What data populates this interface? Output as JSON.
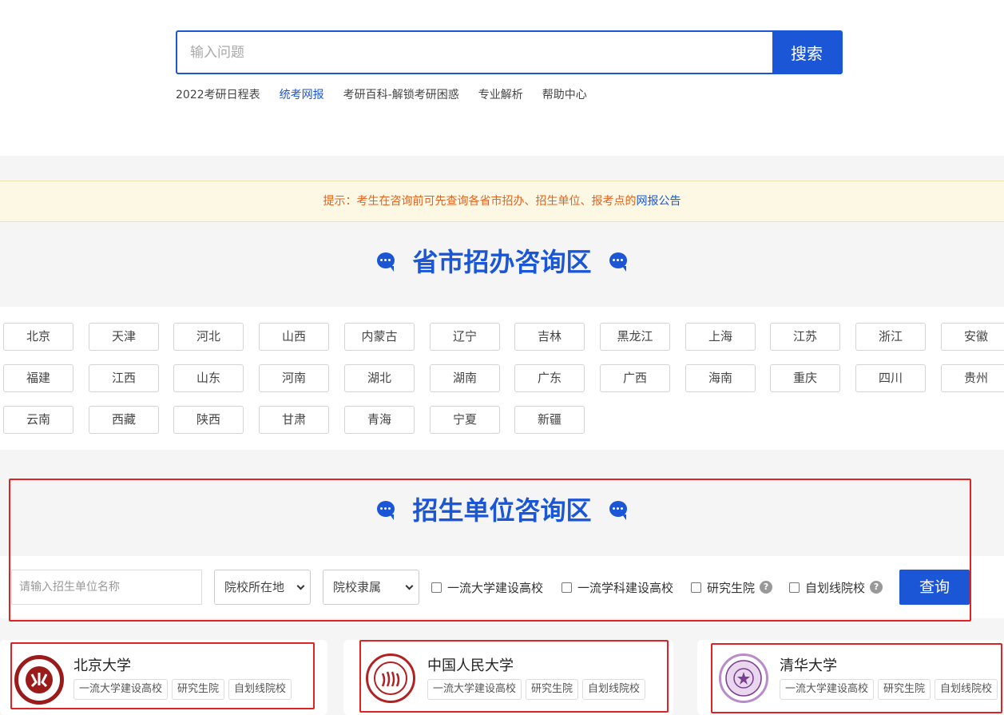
{
  "search": {
    "placeholder": "输入问题",
    "button": "搜索"
  },
  "hot_links": [
    {
      "label": "2022考研日程表",
      "active": false
    },
    {
      "label": "统考网报",
      "active": true
    },
    {
      "label": "考研百科-解锁考研困惑",
      "active": false
    },
    {
      "label": "专业解析",
      "active": false
    },
    {
      "label": "帮助中心",
      "active": false
    }
  ],
  "tip": {
    "text": "提示：考生在咨询前可先查询各省市招办、招生单位、报考点的",
    "link": "网报公告"
  },
  "province_section": {
    "title": "省市招办咨询区",
    "provinces": [
      "北京",
      "天津",
      "河北",
      "山西",
      "内蒙古",
      "辽宁",
      "吉林",
      "黑龙江",
      "上海",
      "江苏",
      "浙江",
      "安徽",
      "福建",
      "江西",
      "山东",
      "河南",
      "湖北",
      "湖南",
      "广东",
      "广西",
      "海南",
      "重庆",
      "四川",
      "贵州",
      "云南",
      "西藏",
      "陕西",
      "甘肃",
      "青海",
      "宁夏",
      "新疆"
    ]
  },
  "unit_section": {
    "title": "招生单位咨询区",
    "name_placeholder": "请输入招生单位名称",
    "location_select": "院校所在地",
    "affiliation_select": "院校隶属",
    "checkboxes": [
      "一流大学建设高校",
      "一流学科建设高校",
      "研究生院",
      "自划线院校"
    ],
    "query_button": "查询"
  },
  "universities": [
    {
      "name": "北京大学",
      "tags": [
        "一流大学建设高校",
        "研究生院",
        "自划线院校"
      ],
      "color": "#9b1b1b"
    },
    {
      "name": "中国人民大学",
      "tags": [
        "一流大学建设高校",
        "研究生院",
        "自划线院校"
      ],
      "color": "#b22222"
    },
    {
      "name": "清华大学",
      "tags": [
        "一流大学建设高校",
        "研究生院",
        "自划线院校"
      ],
      "color": "#7b3f8f"
    }
  ]
}
